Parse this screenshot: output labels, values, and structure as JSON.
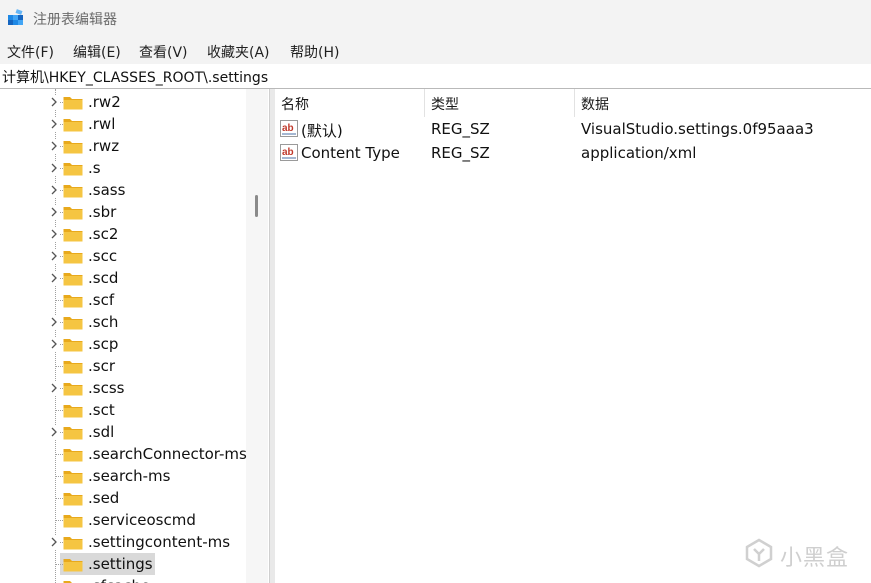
{
  "window": {
    "title": "注册表编辑器",
    "app_icon": "registry-editor-icon"
  },
  "menu": [
    "文件(F)",
    "编辑(E)",
    "查看(V)",
    "收藏夹(A)",
    "帮助(H)"
  ],
  "address": "计算机\\HKEY_CLASSES_ROOT\\.settings",
  "tree": {
    "items": [
      {
        "label": ".rw2",
        "expandable": true
      },
      {
        "label": ".rwl",
        "expandable": true
      },
      {
        "label": ".rwz",
        "expandable": true
      },
      {
        "label": ".s",
        "expandable": true
      },
      {
        "label": ".sass",
        "expandable": true
      },
      {
        "label": ".sbr",
        "expandable": true
      },
      {
        "label": ".sc2",
        "expandable": true
      },
      {
        "label": ".scc",
        "expandable": true
      },
      {
        "label": ".scd",
        "expandable": true
      },
      {
        "label": ".scf",
        "expandable": false
      },
      {
        "label": ".sch",
        "expandable": true
      },
      {
        "label": ".scp",
        "expandable": true
      },
      {
        "label": ".scr",
        "expandable": false
      },
      {
        "label": ".scss",
        "expandable": true
      },
      {
        "label": ".sct",
        "expandable": false
      },
      {
        "label": ".sdl",
        "expandable": true
      },
      {
        "label": ".searchConnector-ms",
        "expandable": false
      },
      {
        "label": ".search-ms",
        "expandable": false
      },
      {
        "label": ".sed",
        "expandable": false
      },
      {
        "label": ".serviceoscmd",
        "expandable": false
      },
      {
        "label": ".settingcontent-ms",
        "expandable": true
      },
      {
        "label": ".settings",
        "expandable": false,
        "selected": true
      },
      {
        "label": ".sfcache",
        "expandable": false
      }
    ]
  },
  "values": {
    "columns": [
      "名称",
      "类型",
      "数据"
    ],
    "rows": [
      {
        "name": "(默认)",
        "type": "REG_SZ",
        "data": "VisualStudio.settings.0f95aaa3",
        "icon": "string-value-icon"
      },
      {
        "name": "Content Type",
        "type": "REG_SZ",
        "data": "application/xml",
        "icon": "string-value-icon"
      }
    ]
  },
  "watermark": "小黑盒",
  "colors": {
    "folder": "#f5c542",
    "selection": "#d9d9d9",
    "ab_icon_red": "#c0392b"
  }
}
